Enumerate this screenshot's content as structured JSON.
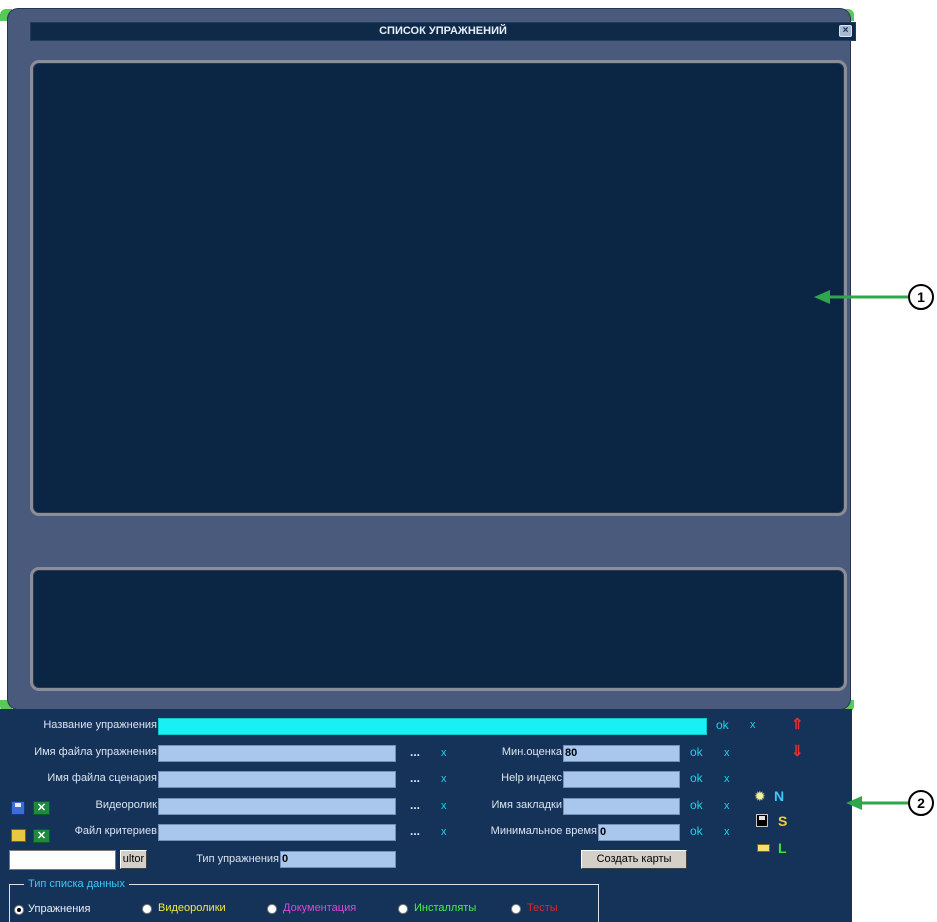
{
  "window": {
    "title": "СПИСОК УПРАЖНЕНИЙ",
    "close_glyph": "×"
  },
  "form": {
    "exercise_name_label": "Название упражнения",
    "exercise_name_value": "",
    "exercise_file_label": "Имя файла упражнения",
    "scenario_file_label": "Имя файла сценария",
    "video_label": "Видеоролик",
    "criteria_file_label": "Файл критериев",
    "exercise_type_label": "Тип упражнения",
    "exercise_type_value": "0",
    "min_score_label": "Мин.оценка",
    "min_score_value": "80",
    "help_index_label": "Help индекс",
    "bookmark_name_label": "Имя закладки",
    "min_time_label": "Минимальное время",
    "min_time_value": "0",
    "ok": "ok",
    "x": "x",
    "dots": "...",
    "create_cards_button": "Создать карты",
    "ultor_button": "ultor",
    "up_arrow": "⇑",
    "down_arrow": "⇓",
    "side_letters": {
      "n": "N",
      "s": "S",
      "l": "L"
    }
  },
  "data_list_group": {
    "legend": "Тип списка данных",
    "options": [
      {
        "label": "Упражнения",
        "color": "#e8eef8",
        "selected": true
      },
      {
        "label": "Видеоролики",
        "color": "#f4e84a",
        "selected": false
      },
      {
        "label": "Документация",
        "color": "#d84ad8",
        "selected": false
      },
      {
        "label": "Инсталляты",
        "color": "#4af04a",
        "selected": false
      },
      {
        "label": "Тесты",
        "color": "#d82828",
        "selected": false
      }
    ]
  },
  "annotations": {
    "one": "1",
    "two": "2"
  },
  "colors": {
    "accent_cyan": "#19f0f4",
    "panel_dark": "#0b2544",
    "window_bg": "#4a5a7c"
  }
}
